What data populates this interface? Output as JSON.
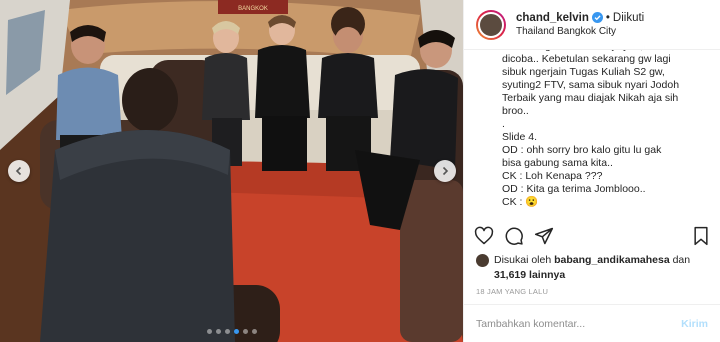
{
  "post": {
    "author": {
      "username": "chand_kelvin",
      "verified": true,
      "follow_status": "Diikuti",
      "separator": "•",
      "location": "Thailand Bangkok City"
    },
    "photo": {
      "sign_text": "BANGKOK",
      "carousel_dots": 6,
      "active_dot": 4
    },
    "caption_lines": [
      "CK : Tari gw sih mauz aja yaa, bolehlah",
      "dicoba.. Kebetulan sekarang gw lagi",
      "sibuk ngerjain Tugas Kuliah S2 gw,",
      "syuting2 FTV, sama sibuk nyari Jodoh",
      "Terbaik yang mau diajak Nikah aja sih",
      "broo..",
      ".",
      "Slide 4.",
      "OD : ohh sorry bro kalo gitu lu gak",
      "bisa gabung sama kita..",
      "CK : Loh Kenapa ???",
      "OD : Kita ga terima Jomblooo..",
      "CK : 😮"
    ],
    "likes": {
      "prefix": "Disukai oleh",
      "liker": "babang_andikamahesa",
      "conjunction": "dan",
      "count": "31,619",
      "suffix": "lainnya"
    },
    "timestamp": "18 JAM YANG LALU",
    "comment": {
      "placeholder": "Tambahkan komentar...",
      "value": "",
      "send_label": "Kirim"
    },
    "icons": {
      "like": "heart-icon",
      "comment": "comment-icon",
      "share": "share-icon",
      "save": "bookmark-icon"
    },
    "colors": {
      "verified_blue": "#3897f0",
      "send_disabled": "#b2dffc",
      "carpet_red": "#c8432a"
    }
  }
}
